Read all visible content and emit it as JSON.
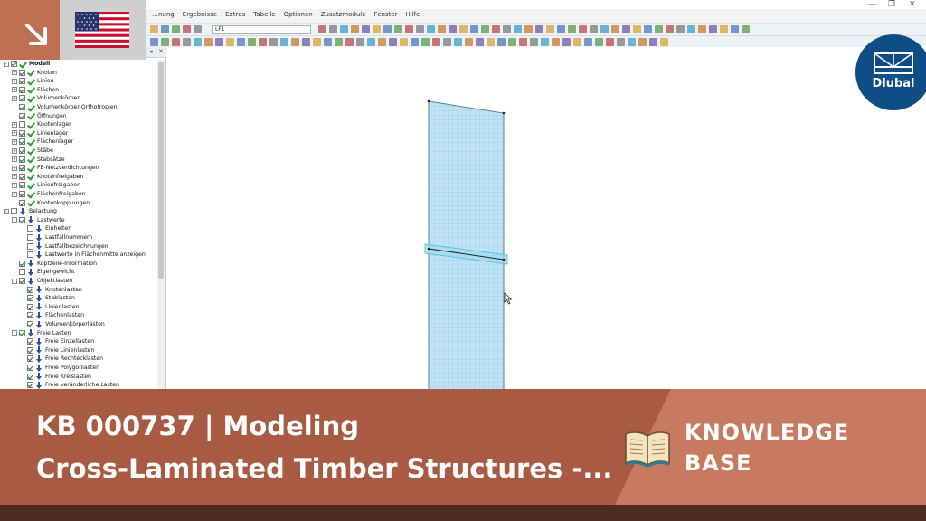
{
  "menu": {
    "items": [
      "…nung",
      "Ergebnisse",
      "Extras",
      "Tabelle",
      "Optionen",
      "Zusatzmodule",
      "Fenster",
      "Hilfe"
    ]
  },
  "toolbar": {
    "loadcase_value": "LF1"
  },
  "navigator": {
    "items": [
      {
        "label": "Modell",
        "level": 0,
        "expander": "-",
        "checked": true,
        "icon": "check-icon",
        "bold": true
      },
      {
        "label": "Knoten",
        "level": 1,
        "expander": "+",
        "checked": true,
        "icon": "check-icon"
      },
      {
        "label": "Linien",
        "level": 1,
        "expander": "+",
        "checked": true,
        "icon": "check-icon"
      },
      {
        "label": "Flächen",
        "level": 1,
        "expander": "+",
        "checked": true,
        "icon": "check-icon"
      },
      {
        "label": "Volumenkörper",
        "level": 1,
        "expander": "+",
        "checked": true,
        "icon": "check-icon"
      },
      {
        "label": "Volumenkörper-Orthotropien",
        "level": 1,
        "expander": "",
        "checked": true,
        "icon": "check-icon"
      },
      {
        "label": "Öffnungen",
        "level": 1,
        "expander": "",
        "checked": true,
        "icon": "check-icon"
      },
      {
        "label": "Knotenlager",
        "level": 1,
        "expander": "+",
        "checked": false,
        "icon": "check-icon"
      },
      {
        "label": "Linienlager",
        "level": 1,
        "expander": "+",
        "checked": true,
        "icon": "check-icon"
      },
      {
        "label": "Flächenlager",
        "level": 1,
        "expander": "+",
        "checked": true,
        "icon": "check-icon"
      },
      {
        "label": "Stäbe",
        "level": 1,
        "expander": "+",
        "checked": true,
        "icon": "check-icon"
      },
      {
        "label": "Stabsätze",
        "level": 1,
        "expander": "+",
        "checked": true,
        "icon": "check-icon"
      },
      {
        "label": "FE-Netzverdichtungen",
        "level": 1,
        "expander": "+",
        "checked": true,
        "icon": "check-icon"
      },
      {
        "label": "Knotenfreigaben",
        "level": 1,
        "expander": "+",
        "checked": true,
        "icon": "check-icon"
      },
      {
        "label": "Linienfreigaben",
        "level": 1,
        "expander": "+",
        "checked": true,
        "icon": "check-icon"
      },
      {
        "label": "Flächenfreigaben",
        "level": 1,
        "expander": "+",
        "checked": true,
        "icon": "check-icon"
      },
      {
        "label": "Knotenkopplungen",
        "level": 1,
        "expander": "",
        "checked": true,
        "icon": "check-icon"
      },
      {
        "label": "Belastung",
        "level": 0,
        "expander": "-",
        "checked": false,
        "icon": "load-icon"
      },
      {
        "label": "Lastwerte",
        "level": 1,
        "expander": "-",
        "checked": true,
        "icon": "load-icon"
      },
      {
        "label": "Einheiten",
        "level": 2,
        "expander": "",
        "checked": false,
        "icon": "load-icon"
      },
      {
        "label": "Lastfallnummern",
        "level": 2,
        "expander": "",
        "checked": false,
        "icon": "load-icon"
      },
      {
        "label": "Lastfallbezeichnungen",
        "level": 2,
        "expander": "",
        "checked": false,
        "icon": "load-icon"
      },
      {
        "label": "Lastwerte in Flächenmitte anzeigen",
        "level": 2,
        "expander": "",
        "checked": false,
        "icon": "load-icon"
      },
      {
        "label": "Kopfzeile-Information",
        "level": 1,
        "expander": "",
        "checked": true,
        "icon": "load-icon"
      },
      {
        "label": "Eigengewicht",
        "level": 1,
        "expander": "",
        "checked": false,
        "icon": "load-icon"
      },
      {
        "label": "Objektlasten",
        "level": 1,
        "expander": "-",
        "checked": true,
        "icon": "load-icon"
      },
      {
        "label": "Knotenlasten",
        "level": 2,
        "expander": "",
        "checked": true,
        "icon": "load-icon"
      },
      {
        "label": "Stablasten",
        "level": 2,
        "expander": "",
        "checked": true,
        "icon": "load-icon"
      },
      {
        "label": "Linienlasten",
        "level": 2,
        "expander": "",
        "checked": true,
        "icon": "load-icon"
      },
      {
        "label": "Flächenlasten",
        "level": 2,
        "expander": "",
        "checked": true,
        "icon": "load-icon"
      },
      {
        "label": "Volumenkörperlasten",
        "level": 2,
        "expander": "",
        "checked": true,
        "icon": "load-icon"
      },
      {
        "label": "Freie Lasten",
        "level": 1,
        "expander": "-",
        "checked": true,
        "icon": "load-icon"
      },
      {
        "label": "Freie Einzellasten",
        "level": 2,
        "expander": "",
        "checked": true,
        "icon": "load-icon"
      },
      {
        "label": "Freie Linienlasten",
        "level": 2,
        "expander": "",
        "checked": true,
        "icon": "load-icon"
      },
      {
        "label": "Freie Rechtecklasten",
        "level": 2,
        "expander": "",
        "checked": true,
        "icon": "load-icon"
      },
      {
        "label": "Freie Polygonlasten",
        "level": 2,
        "expander": "",
        "checked": true,
        "icon": "load-icon"
      },
      {
        "label": "Freie Kreislasten",
        "level": 2,
        "expander": "",
        "checked": true,
        "icon": "load-icon"
      },
      {
        "label": "Freie veränderliche Lasten",
        "level": 2,
        "expander": "",
        "checked": true,
        "icon": "load-icon"
      }
    ]
  },
  "logo": {
    "text": "Dlubal"
  },
  "banner": {
    "title_line1": "KB 000737 | Modeling",
    "title_line2": "Cross-Laminated Timber Structures -...",
    "label_line1": "KNOWLEDGE",
    "label_line2": "BASE"
  },
  "colors": {
    "banner": "#a85a42",
    "banner_right": "#c77a5e",
    "bottom_strip": "#4e2b20",
    "logo": "#0f4d86",
    "plate_fill": "#bfe2f5",
    "plate_grid": "#8ac3e4"
  },
  "icons": {
    "corner": "arrow-down-right-icon",
    "flag": "us-flag-icon",
    "book": "open-book-icon"
  }
}
